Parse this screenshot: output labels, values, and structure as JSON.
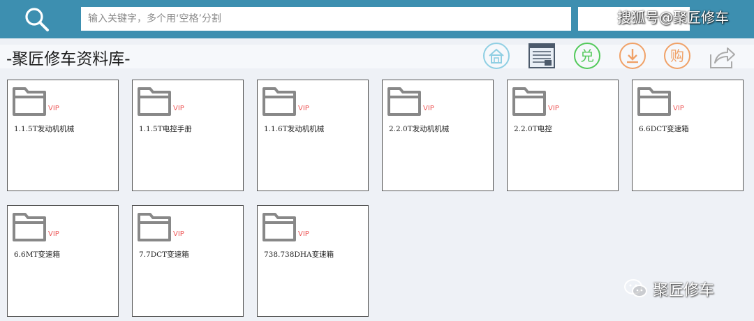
{
  "search": {
    "placeholder": "输入关键字，多个用‘空格’分割",
    "value": ""
  },
  "watermarks": {
    "top": "搜狐号@聚匠修车",
    "bottom": "聚匠修车"
  },
  "page": {
    "title": "-聚匠修车资料库-"
  },
  "toolbar": [
    {
      "icon": "home-icon",
      "color": "#8fcfe3"
    },
    {
      "icon": "list-window-icon",
      "color": "#4c5a6b"
    },
    {
      "icon": "exchange-icon",
      "color": "#52c95a"
    },
    {
      "icon": "download-icon",
      "color": "#f0a167"
    },
    {
      "icon": "buy-icon",
      "color": "#f0a167"
    },
    {
      "icon": "share-icon",
      "color": "#aaaaaa"
    }
  ],
  "folders": [
    {
      "label": "1.1.5T发动机机械",
      "badge": "VIP"
    },
    {
      "label": "1.1.5T电控手册",
      "badge": "VIP"
    },
    {
      "label": "1.1.6T发动机机械",
      "badge": "VIP"
    },
    {
      "label": "2.2.0T发动机机械",
      "badge": "VIP"
    },
    {
      "label": "2.2.0T电控",
      "badge": "VIP"
    },
    {
      "label": "6.6DCT变速箱",
      "badge": "VIP"
    },
    {
      "label": "6.6MT变速箱",
      "badge": "VIP"
    },
    {
      "label": "7.7DCT变速箱",
      "badge": "VIP"
    },
    {
      "label": "738.738DHA变速箱",
      "badge": "VIP"
    }
  ]
}
